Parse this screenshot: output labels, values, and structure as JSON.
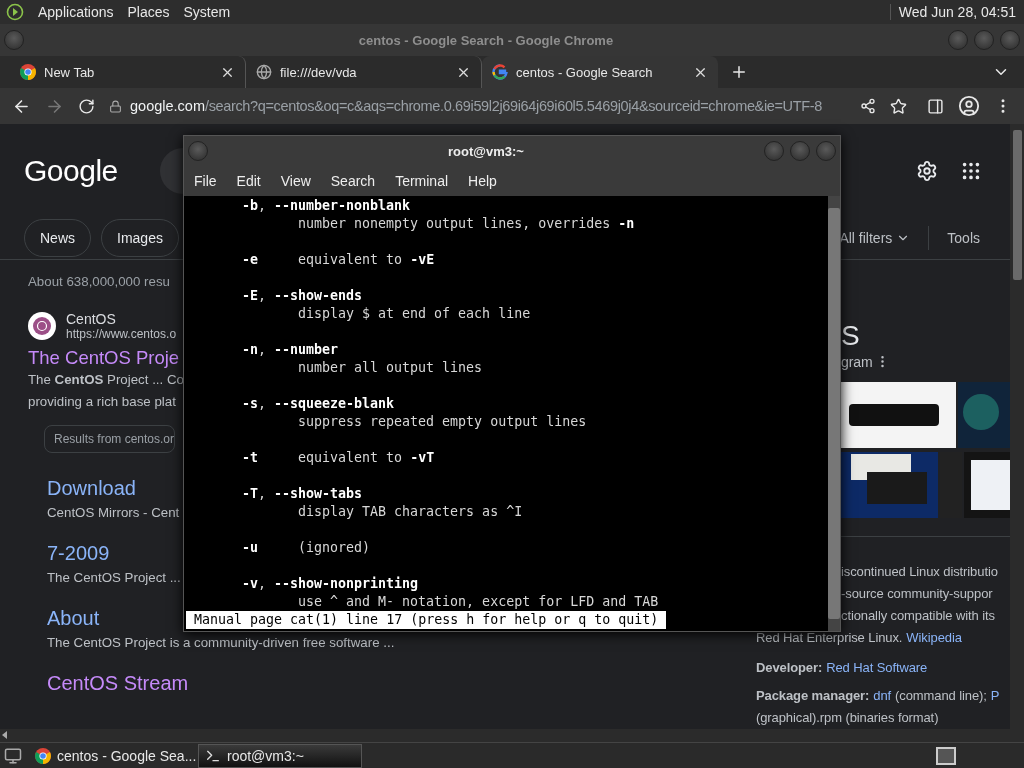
{
  "top_panel": {
    "menus": [
      "Applications",
      "Places",
      "System"
    ],
    "clock": "Wed Jun 28, 04:51"
  },
  "browser": {
    "title": "centos - Google Search - Google Chrome",
    "tabs": [
      {
        "label": "New Tab",
        "kind": "newtab",
        "selected": false
      },
      {
        "label": "file:///dev/vda",
        "kind": "file",
        "selected": false
      },
      {
        "label": "centos - Google Search",
        "kind": "google",
        "selected": true
      }
    ],
    "address_bar": {
      "host": "google.com",
      "path": "/search?q=centos&oq=c&aqs=chrome.0.69i59l2j69i64j69i60l5.5469j0j4&sourceid=chrome&ie=UTF-8",
      "forward_disabled": true
    },
    "page": {
      "logo": "Google",
      "chips": [
        "News",
        "Images"
      ],
      "filters": "All filters",
      "tools": "Tools",
      "result_count": "About 638,000,000 resu",
      "result": {
        "site": "CentOS",
        "url": "https://www.centos.o",
        "title": "The CentOS Proje",
        "visited": true,
        "snippet": [
          "The **CentOS** Project ... Co",
          "providing a rich base plat"
        ],
        "more": "Results from centos.or",
        "sitelinks": [
          {
            "title": "Download",
            "snippet": "CentOS Mirrors - Cent",
            "visited": false
          },
          {
            "title": "7-2009",
            "snippet": "The CentOS Project ...",
            "visited": false
          },
          {
            "title": "About",
            "snippet": "The CentOS Project is a community-driven free software ...",
            "visited": false
          },
          {
            "title": "CentOS Stream",
            "visited": true
          }
        ]
      },
      "panel": {
        "title": "S",
        "subtitle": "gram",
        "description": [
          "iscontinued Linux distributio",
          "-source community-suppor",
          "ctionally compatible with its"
        ],
        "facts": [
          [
            {
              "kind": "text",
              "text": "Red Hat Enterprise Linux."
            },
            {
              "kind": "link",
              "text": "Wikipedia"
            }
          ],
          [
            {
              "kind": "label",
              "text": "Developer:"
            },
            {
              "kind": "link",
              "text": "Red Hat Software"
            }
          ],
          [
            {
              "kind": "label",
              "text": "Package manager:"
            },
            {
              "kind": "link",
              "text": "dnf"
            },
            {
              "kind": "text",
              "text": "(command line);"
            },
            {
              "kind": "link",
              "text": "P"
            }
          ],
          [
            {
              "kind": "text",
              "text": "(graphical).rpm (binaries format)"
            }
          ]
        ]
      }
    }
  },
  "terminal": {
    "title": "root@vm3:~",
    "menus": [
      "File",
      "Edit",
      "View",
      "Search",
      "Terminal",
      "Help"
    ],
    "lines": [
      {
        "kind": "option",
        "text": "**-b**, **--number-nonblank**"
      },
      {
        "kind": "desc",
        "text": "number nonempty output lines, overrides **-n**"
      },
      {
        "kind": "blank"
      },
      {
        "kind": "option",
        "text": "**-e**     equivalent to **-vE**"
      },
      {
        "kind": "blank"
      },
      {
        "kind": "option",
        "text": "**-E**, **--show-ends**"
      },
      {
        "kind": "desc",
        "text": "display $ at end of each line"
      },
      {
        "kind": "blank"
      },
      {
        "kind": "option",
        "text": "**-n**, **--number**"
      },
      {
        "kind": "desc",
        "text": "number all output lines"
      },
      {
        "kind": "blank"
      },
      {
        "kind": "option",
        "text": "**-s**, **--squeeze-blank**"
      },
      {
        "kind": "desc",
        "text": "suppress repeated empty output lines"
      },
      {
        "kind": "blank"
      },
      {
        "kind": "option",
        "text": "**-t**     equivalent to **-vT**"
      },
      {
        "kind": "blank"
      },
      {
        "kind": "option",
        "text": "**-T**, **--show-tabs**"
      },
      {
        "kind": "desc",
        "text": "display TAB characters as ^I"
      },
      {
        "kind": "blank"
      },
      {
        "kind": "option",
        "text": "**-u**     (ignored)"
      },
      {
        "kind": "blank"
      },
      {
        "kind": "option",
        "text": "**-v**, **--show-nonprinting**"
      },
      {
        "kind": "desc",
        "text": "use ^ and M- notation, except for LFD and TAB"
      }
    ],
    "status": "Manual page cat(1) line 17 (press h for help or q to quit)"
  },
  "taskbar": {
    "tasks": [
      {
        "label": "centos - Google Sea...",
        "kind": "browser",
        "selected": false
      },
      {
        "label": "root@vm3:~",
        "kind": "terminal",
        "selected": true
      }
    ]
  }
}
